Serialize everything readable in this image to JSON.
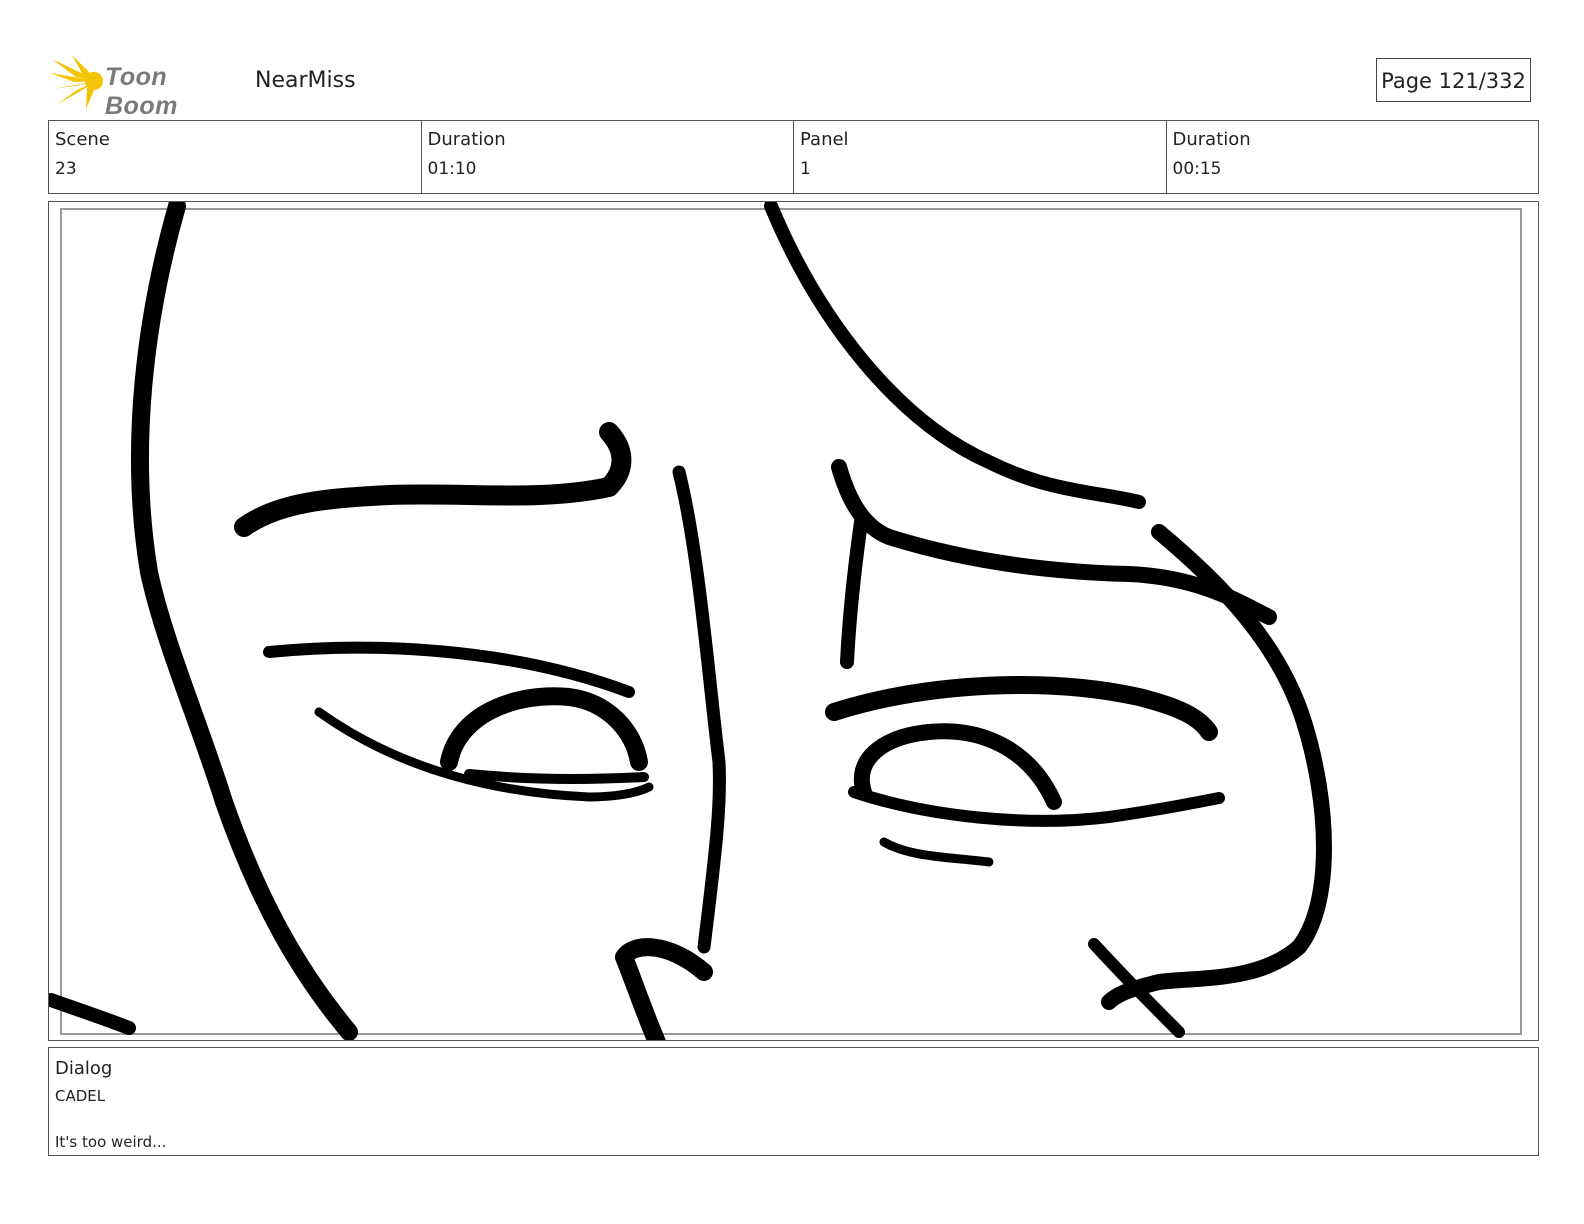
{
  "header": {
    "logo_text": "Toon Boom",
    "project_name": "NearMiss",
    "page_label": "Page 121/332"
  },
  "info": {
    "scene_label": "Scene",
    "scene_value": "23",
    "scene_duration_label": "Duration",
    "scene_duration_value": "01:10",
    "panel_label": "Panel",
    "panel_value": "1",
    "panel_duration_label": "Duration",
    "panel_duration_value": "00:15"
  },
  "dialog": {
    "title": "Dialog",
    "speaker": "CADEL",
    "line": "It's too weird..."
  },
  "colors": {
    "logo_star": "#f5c400",
    "ink": "#000000",
    "frame_guide": "#999999"
  }
}
